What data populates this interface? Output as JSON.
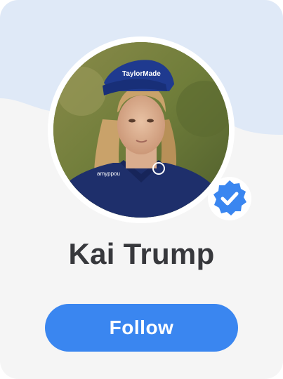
{
  "profile": {
    "name": "Kai Trump",
    "verified": true,
    "avatar_icon": "person-photo-golfer"
  },
  "actions": {
    "follow_label": "Follow"
  },
  "colors": {
    "card_background": "#f5f5f5",
    "banner": "#dfe9f7",
    "accent": "#3a86f0",
    "name_text": "#37383c",
    "button_text": "#ffffff"
  }
}
